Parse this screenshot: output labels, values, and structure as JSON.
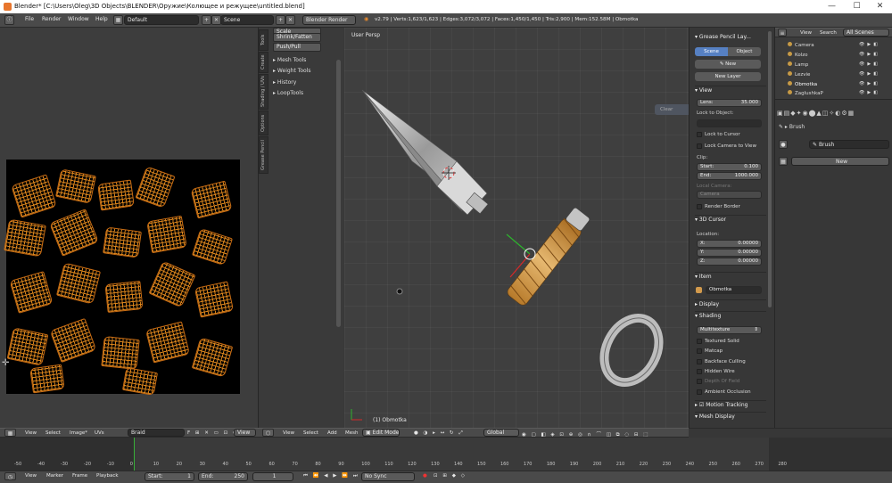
{
  "window": {
    "title": "Blender* [C:\\Users\\Oleg\\3D Objects\\BLENDER\\Оружие\\Колющее и режущее\\untitled.blend]",
    "minimize": "—",
    "maximize": "☐",
    "close": "✕"
  },
  "topbar": {
    "menus": [
      "File",
      "Render",
      "Window",
      "Help"
    ],
    "layout": "Default",
    "scene": "Scene",
    "engine": "Blender Render",
    "stats": "v2.79 | Verts:1,623/1,623 | Edges:3,072/3,072 | Faces:1,450/1,450 | Tris:2,900 | Mem:152.58M | Obmotka"
  },
  "tool_shelf": {
    "tabs": [
      "Tools",
      "Create",
      "Shading / UVs",
      "Options",
      "Grease Pencil"
    ],
    "buttons": [
      "Scale",
      "Shrink/Fatten",
      "Push/Pull"
    ],
    "panels": [
      "Mesh Tools",
      "Weight Tools",
      "History",
      "LoopTools"
    ]
  },
  "viewport": {
    "label": "User Persp",
    "object_label": "(1) Obmotka",
    "hint": "Clear"
  },
  "n_panel": {
    "grease_pencil": "Grease Pencil Lay...",
    "scene_btn": "Scene",
    "object_btn": "Object",
    "new": "New",
    "new_layer": "New Layer",
    "view": "View",
    "lens_label": "Lens:",
    "lens_value": "35.000",
    "lock_to_object": "Lock to Object:",
    "lock_to_cursor": "Lock to Cursor",
    "lock_camera": "Lock Camera to View",
    "clip": "Clip:",
    "clip_start_label": "Start:",
    "clip_start": "0.100",
    "clip_end_label": "End:",
    "clip_end": "1000.000",
    "local_camera": "Local Camera:",
    "camera_field": "Camera",
    "render_border": "Render Border",
    "cursor_3d": "3D Cursor",
    "location": "Location:",
    "loc_x_label": "X:",
    "loc_x": "0.00000",
    "loc_y_label": "Y:",
    "loc_y": "0.00000",
    "loc_z_label": "Z:",
    "loc_z": "0.00000",
    "item": "Item",
    "item_name": "Obmotka",
    "display": "Display",
    "shading": "Shading",
    "shading_mode": "Multitexture",
    "textured_solid": "Textured Solid",
    "matcap": "Matcap",
    "backface": "Backface Culling",
    "hidden_wire": "Hidden Wire",
    "dof": "Depth Of Field",
    "ao": "Ambient Occlusion",
    "motion_tracking": "Motion Tracking",
    "mesh_display": "Mesh Display"
  },
  "outliner": {
    "view": "View",
    "search": "Search",
    "scenes": "All Scenes",
    "items": [
      "Camera",
      "Kolzo",
      "Lamp",
      "Lezvie",
      "Obmotka",
      "ZaglushkaP"
    ]
  },
  "brush_panel": {
    "brush": "Brush",
    "brush_field": "Brush",
    "new": "New"
  },
  "uv_header": {
    "menus": [
      "View",
      "Select",
      "Image*",
      "UVs"
    ],
    "image": "Braid",
    "view_btn": "View"
  },
  "view3d_header": {
    "menus": [
      "View",
      "Select",
      "Add",
      "Mesh"
    ],
    "mode": "Edit Mode",
    "orientation": "Global"
  },
  "timeline": {
    "ticks": [
      "-50",
      "-40",
      "-30",
      "-20",
      "-10",
      "0",
      "10",
      "20",
      "30",
      "40",
      "50",
      "60",
      "70",
      "80",
      "90",
      "100",
      "110",
      "120",
      "130",
      "140",
      "150",
      "160",
      "170",
      "180",
      "190",
      "200",
      "210",
      "220",
      "230",
      "240",
      "250",
      "260",
      "270",
      "280"
    ],
    "menus": [
      "View",
      "Marker",
      "Frame",
      "Playback"
    ],
    "start_label": "Start:",
    "start": "1",
    "end_label": "End:",
    "end": "250",
    "current": "1",
    "sync": "No Sync"
  },
  "colors": {
    "accent": "#5680c2",
    "uv_wire": "#e68c1e",
    "handle": "#d29a4c"
  }
}
